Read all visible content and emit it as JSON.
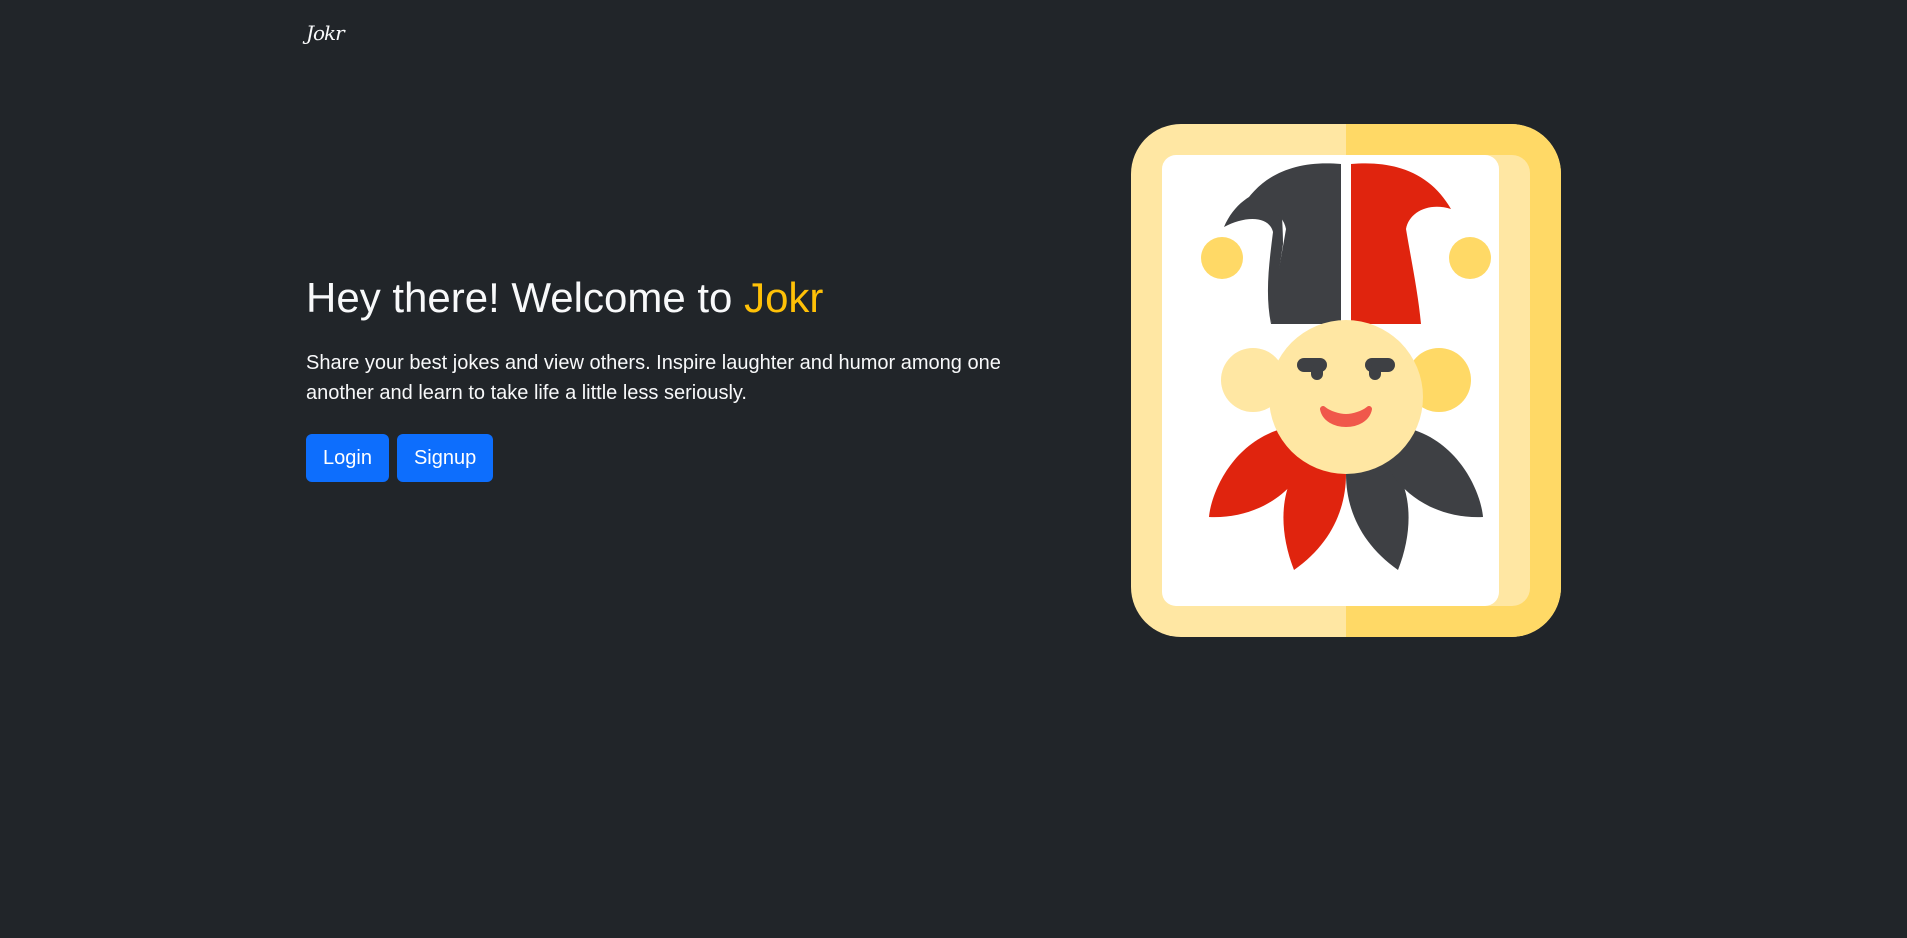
{
  "navbar": {
    "brand": "Jokr"
  },
  "hero": {
    "headline_prefix": "Hey there! Welcome to ",
    "headline_brand": "Jokr",
    "description": "Share your best jokes and view others. Inspire laughter and humor among one another and learn to take life a little less seriously.",
    "login_label": "Login",
    "signup_label": "Signup"
  },
  "illustration": {
    "icon": "jester-card-icon"
  },
  "colors": {
    "background": "#212529",
    "accent": "#ffc107",
    "primary_button": "#0d6efd",
    "text": "#f8f9fa"
  }
}
